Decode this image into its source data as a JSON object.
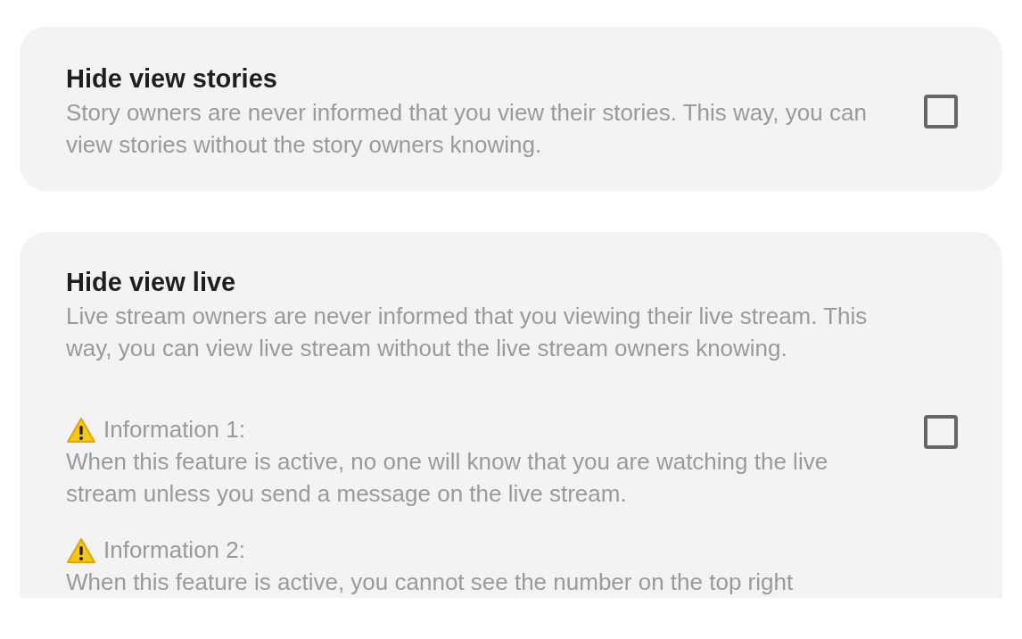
{
  "settings": [
    {
      "title": "Hide view stories",
      "description": "Story owners are never informed that you view their stories. This way, you can view stories without the story owners knowing.",
      "checked": false
    },
    {
      "title": "Hide view live",
      "description": "Live stream owners are never informed that you viewing their live stream. This way, you can view live stream without the live stream owners knowing.",
      "checked": false,
      "notes": [
        {
          "label": "Information 1:",
          "text": "When this feature is active, no one will know that you are watching the live stream unless you send a message on the live stream."
        },
        {
          "label": "Information 2:",
          "text": "When this feature is active, you cannot see the number on the top right"
        }
      ]
    }
  ]
}
